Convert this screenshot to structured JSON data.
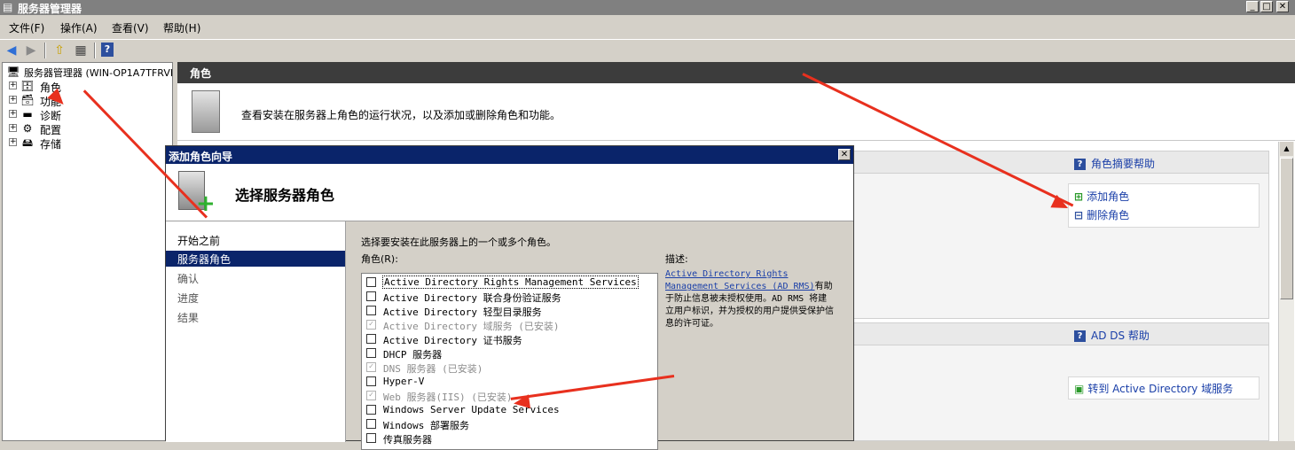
{
  "window": {
    "title": "服务器管理器",
    "min": "_",
    "max": "□",
    "close": "✕"
  },
  "menu": [
    "文件(F)",
    "操作(A)",
    "查看(V)",
    "帮助(H)"
  ],
  "tree": {
    "root": "服务器管理器 (WIN-OP1A7TFRVI",
    "items": [
      "角色",
      "功能",
      "诊断",
      "配置",
      "存储"
    ]
  },
  "main": {
    "header": "角色",
    "intro": "查看安装在服务器上角色的运行状况，以及添加或删除角色和功能。",
    "summary_help": "角色摘要帮助",
    "add_roles": "添加角色",
    "remove_roles": "删除角色",
    "adds_help": "AD DS 帮助",
    "goto_adds": "转到 Active Directory 域服务"
  },
  "dialog": {
    "title": "添加角色向导",
    "close": "✕",
    "heading": "选择服务器角色",
    "nav": [
      "开始之前",
      "服务器角色",
      "确认",
      "进度",
      "结果"
    ],
    "instruction": "选择要安装在此服务器上的一个或多个角色。",
    "roles_label": "角色(R):",
    "description_label": "描述:",
    "description_link": "Active Directory Rights Management Services (AD RMS)",
    "description_text": "有助于防止信息被未授权使用。AD RMS 将建立用户标识，并为授权的用户提供受保护信息的许可证。",
    "roles": [
      {
        "label": "Active Directory Rights Management Services",
        "checked": false,
        "disabled": false
      },
      {
        "label": "Active Directory 联合身份验证服务",
        "checked": false,
        "disabled": false
      },
      {
        "label": "Active Directory 轻型目录服务",
        "checked": false,
        "disabled": false
      },
      {
        "label": "Active Directory 域服务  (已安装)",
        "checked": true,
        "disabled": true
      },
      {
        "label": "Active Directory 证书服务",
        "checked": false,
        "disabled": false
      },
      {
        "label": "DHCP 服务器",
        "checked": false,
        "disabled": false
      },
      {
        "label": "DNS 服务器  (已安装)",
        "checked": true,
        "disabled": true
      },
      {
        "label": "Hyper-V",
        "checked": false,
        "disabled": false
      },
      {
        "label": "Web 服务器(IIS)  (已安装)",
        "checked": true,
        "disabled": true
      },
      {
        "label": "Windows Server Update Services",
        "checked": false,
        "disabled": false
      },
      {
        "label": "Windows 部署服务",
        "checked": false,
        "disabled": false
      },
      {
        "label": "传真服务器",
        "checked": false,
        "disabled": false
      }
    ]
  },
  "colors": {
    "annotation_arrow": "#e8301e",
    "dialog_title": "#0a246a",
    "link": "#1a3fa8"
  }
}
